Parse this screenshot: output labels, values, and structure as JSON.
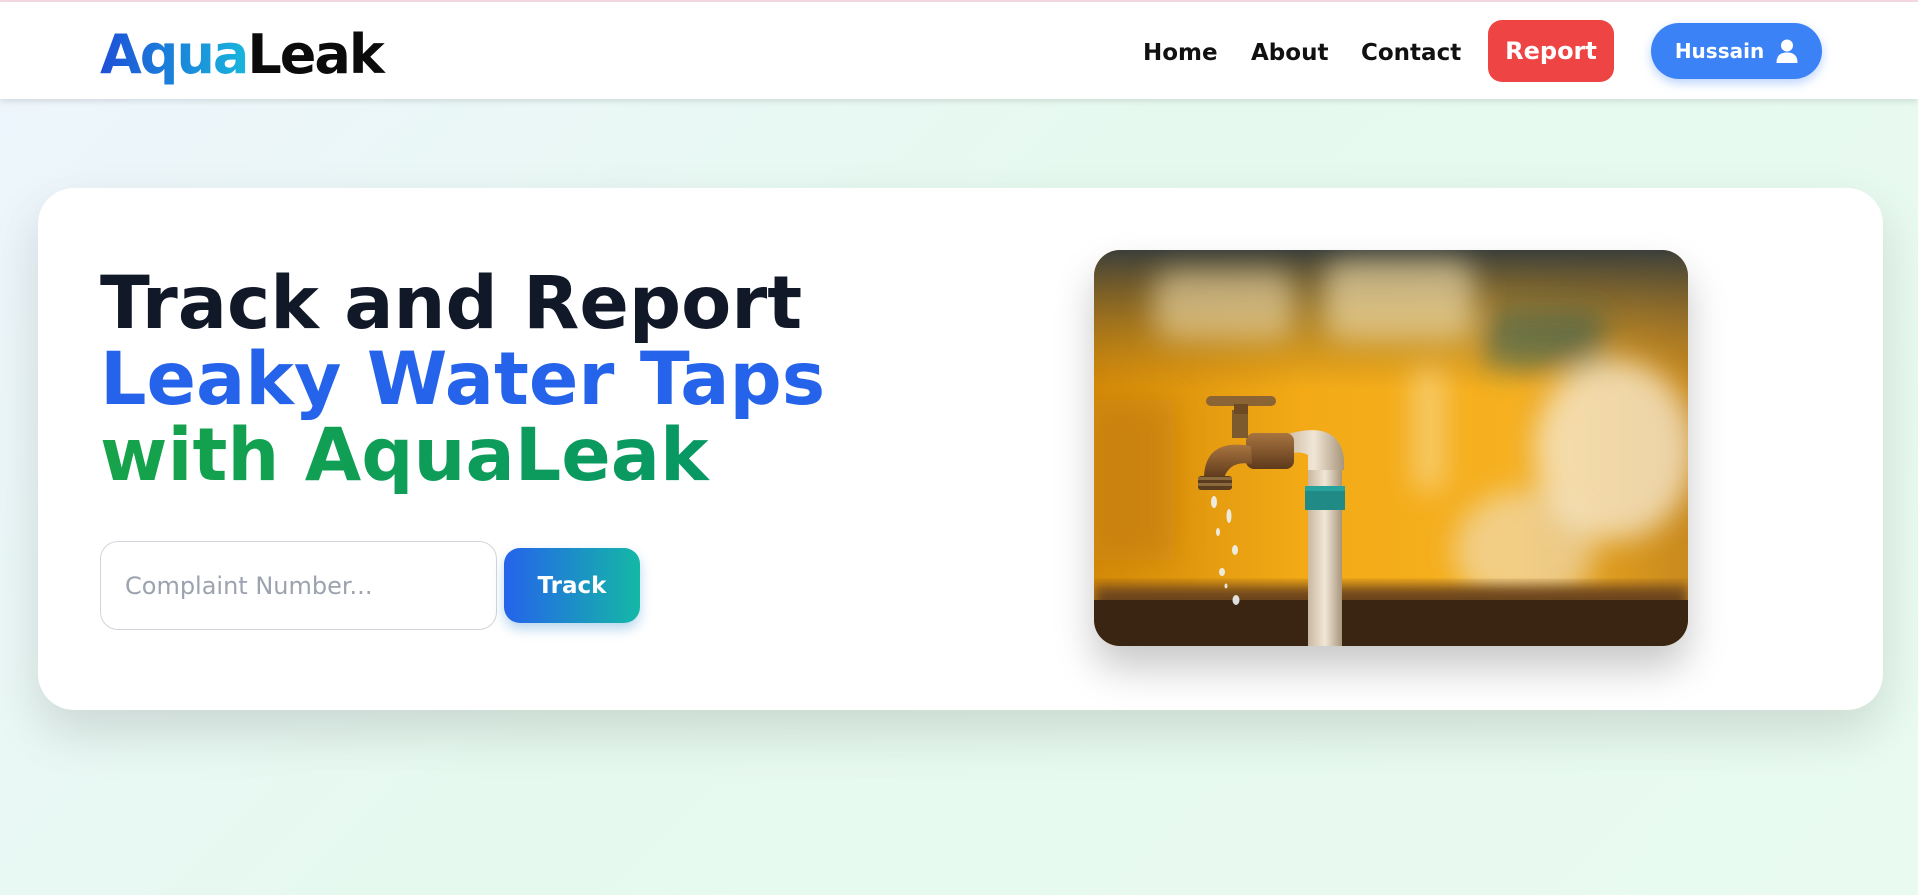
{
  "brand": {
    "part1": "Aqua",
    "part2": "Leak"
  },
  "nav": {
    "home": "Home",
    "about": "About",
    "contact": "Contact",
    "report": "Report",
    "user_name": "Hussain"
  },
  "hero": {
    "line1": "Track and Report",
    "line2": "Leaky Water Taps",
    "line3": "with AquaLeak",
    "search_placeholder": "Complaint Number...",
    "track_label": "Track",
    "image_icon": "leaky-tap-photo"
  },
  "colors": {
    "report": "#ef4444",
    "user": "#3b82f6",
    "headline_blue": "#2563eb",
    "headline_green": "#16a34a",
    "headline_dark": "#111827"
  }
}
